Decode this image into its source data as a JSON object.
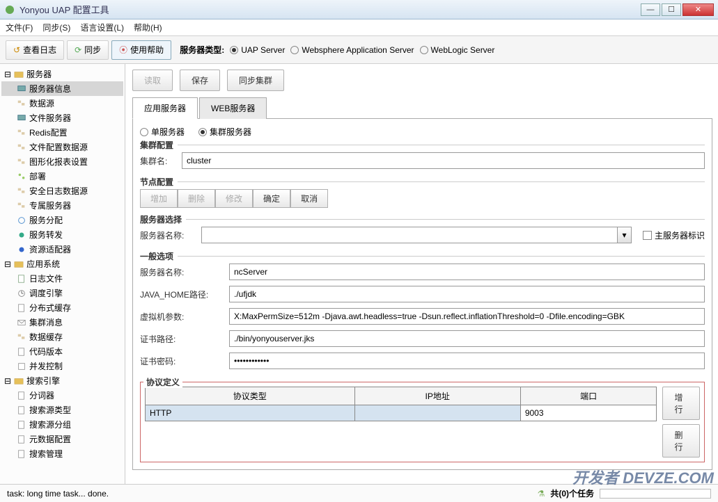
{
  "window": {
    "title": "Yonyou UAP 配置工具"
  },
  "menu": {
    "file": "文件(F)",
    "sync": "同步(S)",
    "lang": "语言设置(L)",
    "help": "帮助(H)"
  },
  "toolbar": {
    "viewlog": "查看日志",
    "sync": "同步",
    "usehelp": "使用帮助",
    "server_type_label": "服务器类型:",
    "types": {
      "uap": "UAP Server",
      "was": "Websphere Application Server",
      "wls": "WebLogic Server"
    }
  },
  "tree": {
    "g1": "服务器",
    "g1_items": [
      "服务器信息",
      "数据源",
      "文件服务器",
      "Redis配置",
      "文件配置数据源",
      "图形化报表设置",
      "部署",
      "安全日志数据源",
      "专属服务器",
      "服务分配",
      "服务转发",
      "资源适配器"
    ],
    "g2": "应用系统",
    "g2_items": [
      "日志文件",
      "调度引擎",
      "分布式缓存",
      "集群消息",
      "数据缓存",
      "代码版本",
      "并发控制"
    ],
    "g3": "搜索引擎",
    "g3_items": [
      "分词器",
      "搜索源类型",
      "搜索源分组",
      "元数据配置",
      "搜索管理"
    ]
  },
  "actions": {
    "read": "读取",
    "save": "保存",
    "sync_cluster": "同步集群"
  },
  "tabs": {
    "app_server": "应用服务器",
    "web_server": "WEB服务器"
  },
  "server_mode": {
    "single": "单服务器",
    "cluster": "集群服务器"
  },
  "cluster_cfg": {
    "legend": "集群配置",
    "name_label": "集群名:",
    "name_value": "cluster"
  },
  "node_cfg": {
    "legend": "节点配置",
    "btns": {
      "add": "增加",
      "delete": "删除",
      "modify": "修改",
      "ok": "确定",
      "cancel": "取消"
    }
  },
  "server_select": {
    "legend": "服务器选择",
    "name_label": "服务器名称:",
    "name_value": "",
    "main_flag": "主服务器标识"
  },
  "general": {
    "legend": "一般选项",
    "name_label": "服务器名称:",
    "name_value": "ncServer",
    "java_home_label": "JAVA_HOME路径:",
    "java_home_value": "./ufjdk",
    "vm_args_label": "虚拟机参数:",
    "vm_args_value": "X:MaxPermSize=512m -Djava.awt.headless=true -Dsun.reflect.inflationThreshold=0 -Dfile.encoding=GBK",
    "cert_path_label": "证书路径:",
    "cert_path_value": "./bin/yonyouserver.jks",
    "cert_pwd_label": "证书密码:",
    "cert_pwd_value": "••••••••••••"
  },
  "protocol": {
    "legend": "协议定义",
    "headers": {
      "type": "协议类型",
      "ip": "IP地址",
      "port": "端口"
    },
    "row": {
      "type": "HTTP",
      "ip": "",
      "port": "9003"
    },
    "add_row": "增行",
    "del_row": "删行"
  },
  "status": {
    "task": "task: long time task... done.",
    "tasks_label": "共(0)个任务"
  },
  "watermark": "开发者 DEVZE.COM"
}
